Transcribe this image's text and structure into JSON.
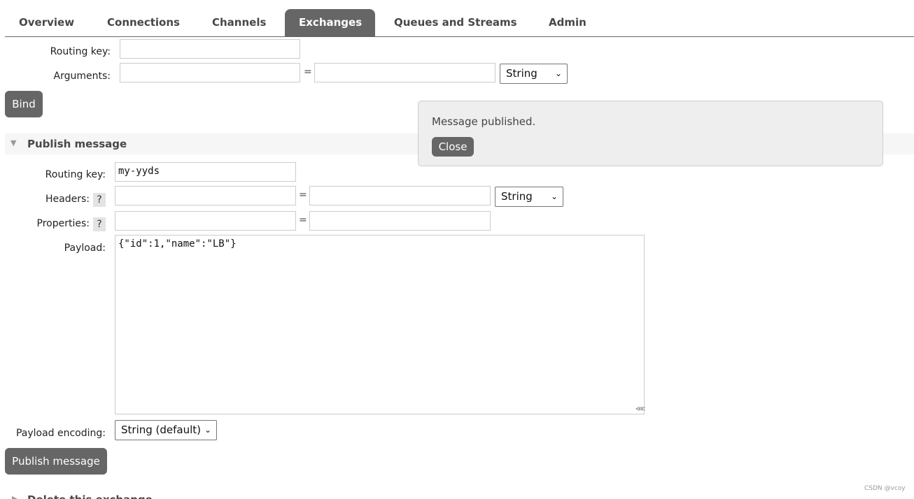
{
  "nav": {
    "tabs": [
      {
        "label": "Overview"
      },
      {
        "label": "Connections"
      },
      {
        "label": "Channels"
      },
      {
        "label": "Exchanges",
        "active": true
      },
      {
        "label": "Queues and Streams"
      },
      {
        "label": "Admin"
      }
    ]
  },
  "bind_form": {
    "routing_key_label": "Routing key:",
    "routing_key_value": "",
    "arguments_label": "Arguments:",
    "eq": "=",
    "type_select": "String",
    "bind_button": "Bind"
  },
  "publish": {
    "section_title": "Publish message",
    "routing_key_label": "Routing key:",
    "routing_key_value": "my-yyds",
    "headers_label": "Headers:",
    "properties_label": "Properties:",
    "help": "?",
    "eq": "=",
    "headers_type": "String",
    "payload_label": "Payload:",
    "payload_value": "{\"id\":1,\"name\":\"LB\"}",
    "encoding_label": "Payload encoding:",
    "encoding_value": "String (default)",
    "publish_button": "Publish message"
  },
  "notification": {
    "message": "Message published.",
    "close_button": "Close"
  },
  "next_section": {
    "title": "Delete this exchange"
  },
  "watermark": "CSDN @vcoy"
}
